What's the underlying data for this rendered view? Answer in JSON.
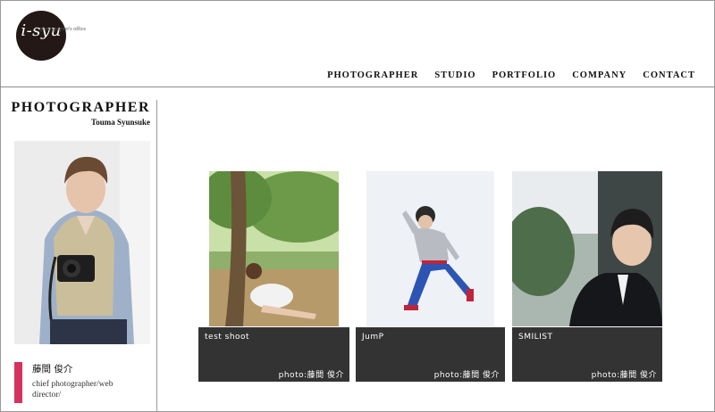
{
  "brand": {
    "logo_text": "i-syu",
    "logo_subtext": "photographer's office"
  },
  "nav": {
    "items": [
      {
        "label": "PHOTOGRAPHER"
      },
      {
        "label": "STUDIO"
      },
      {
        "label": "PORTFOLIO"
      },
      {
        "label": "COMPANY"
      },
      {
        "label": "CONTACT"
      }
    ]
  },
  "sidebar": {
    "title": "PHOTOGRAPHER",
    "subtitle": "Touma Syunsuke",
    "name": "藤間 俊介",
    "role": "chief photographer/web director/",
    "accent_color": "#d4335e"
  },
  "gallery": {
    "items": [
      {
        "title": "test shoot",
        "credit": "photo:藤間 俊介"
      },
      {
        "title": "JumP",
        "credit": "photo:藤間 俊介"
      },
      {
        "title": "SMILIST",
        "credit": "photo:藤間 俊介"
      }
    ]
  }
}
